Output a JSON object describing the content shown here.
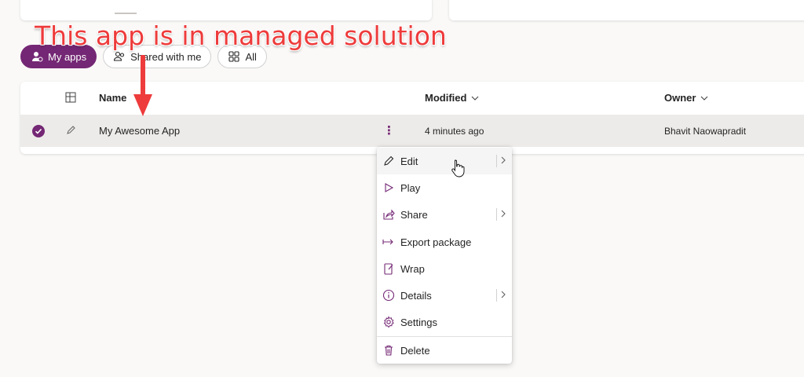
{
  "annotation": {
    "text": "This app is in managed solution"
  },
  "filters": [
    {
      "label": "My apps"
    },
    {
      "label": "Shared with me"
    },
    {
      "label": "All"
    }
  ],
  "table": {
    "columns": {
      "name": "Name",
      "modified": "Modified",
      "owner": "Owner"
    },
    "rows": [
      {
        "name": "My Awesome App",
        "modified": "4 minutes ago",
        "owner": "Bhavit Naowapradit",
        "selected": true
      }
    ]
  },
  "context_menu": {
    "items": [
      {
        "label": "Edit",
        "icon": "pencil-icon",
        "submenu": true
      },
      {
        "label": "Play",
        "icon": "play-icon",
        "submenu": false
      },
      {
        "label": "Share",
        "icon": "share-icon",
        "submenu": true
      },
      {
        "label": "Export package",
        "icon": "export-icon",
        "submenu": false
      },
      {
        "label": "Wrap",
        "icon": "wrap-icon",
        "submenu": false
      },
      {
        "label": "Details",
        "icon": "info-icon",
        "submenu": true
      },
      {
        "label": "Settings",
        "icon": "gear-icon",
        "submenu": false
      },
      {
        "label": "Delete",
        "icon": "trash-icon",
        "submenu": false
      }
    ]
  },
  "colors": {
    "accent": "#742774",
    "annotation": "#ee3b3b"
  }
}
